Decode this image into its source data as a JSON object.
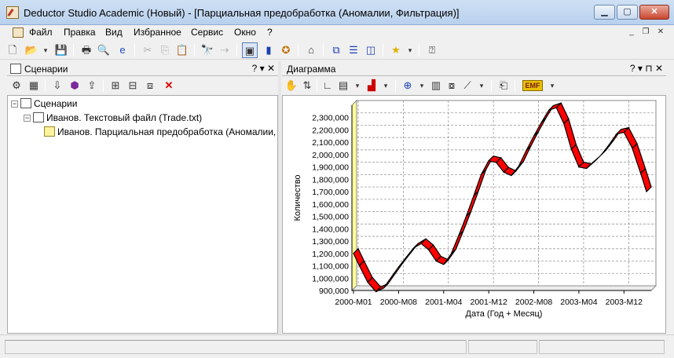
{
  "window": {
    "title": "Deductor Studio Academic (Новый) - [Парциальная предобработка (Аномалии, Фильтрация)]",
    "minimize_glyph": "▁",
    "maximize_glyph": "▢",
    "close_glyph": "✕"
  },
  "menu": {
    "items": [
      "Файл",
      "Правка",
      "Вид",
      "Избранное",
      "Сервис",
      "Окно",
      "?"
    ],
    "mdi_minimize": "_",
    "mdi_restore": "❐",
    "mdi_close": "✕"
  },
  "toolbar_icons": [
    "new-icon",
    "open-icon",
    "save-icon",
    "print-icon",
    "preview-icon",
    "internet-icon",
    "cut-icon",
    "copy-icon",
    "paste-icon",
    "find-icon",
    "find-next-icon",
    "scenarios-icon",
    "data-icon",
    "wizard-icon",
    "home-icon",
    "window-cascade-icon",
    "window-horizontal-icon",
    "window-vertical-icon",
    "favorites-icon",
    "help-icon"
  ],
  "left_panel": {
    "title": "Сценарии",
    "header_buttons": "? ▾ ✕",
    "tree": [
      {
        "label": "Сценарии"
      },
      {
        "label": "Иванов. Текстовый файл (Trade.txt)"
      },
      {
        "label": "Иванов. Парциальная предобработка (Аномалии, Фильтрация)"
      }
    ]
  },
  "right_panel": {
    "title": "Диаграмма",
    "header_buttons": "? ▾ ⊓ ✕",
    "emf_label": "EMF"
  },
  "chart_data": {
    "type": "line",
    "title": "",
    "xlabel": "Дата (Год + Месяц)",
    "ylabel": "Количество",
    "ylim": [
      900000,
      2400000
    ],
    "yticks": [
      "900,000",
      "1,000,000",
      "1,100,000",
      "1,200,000",
      "1,300,000",
      "1,400,000",
      "1,500,000",
      "1,600,000",
      "1,700,000",
      "1,800,000",
      "1,900,000",
      "2,000,000",
      "2,100,000",
      "2,200,000",
      "2,300,000"
    ],
    "x_tick_labels": [
      "2000-M01",
      "2000-M08",
      "2001-M04",
      "2001-M12",
      "2002-M08",
      "2003-M04",
      "2003-M12"
    ],
    "grid": true,
    "series": [
      {
        "style": "3D ribbon",
        "color": "#ff0000",
        "x": [
          "2000-M01",
          "2000-M04",
          "2000-M08",
          "2000-M12",
          "2001-M04",
          "2001-M08",
          "2001-M12",
          "2002-M04",
          "2002-M08",
          "2002-M12",
          "2003-M04",
          "2003-M08",
          "2003-M12",
          "2004-M02"
        ],
        "values": [
          1200000,
          890000,
          1090000,
          1280000,
          1110000,
          1500000,
          1950000,
          1830000,
          2150000,
          2380000,
          1900000,
          2000000,
          2180000,
          1700000
        ]
      }
    ]
  },
  "status": {
    "cells": [
      "",
      "",
      ""
    ]
  }
}
